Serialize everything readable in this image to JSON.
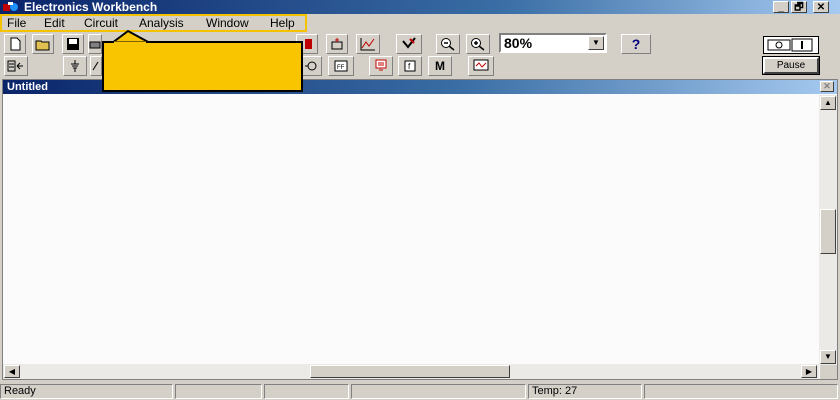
{
  "app": {
    "title": "Electronics Workbench"
  },
  "window_controls": {
    "minimize": "_",
    "restore": "🗗",
    "close": "✕"
  },
  "menu": [
    {
      "label": "File"
    },
    {
      "label": "Edit"
    },
    {
      "label": "Circuit"
    },
    {
      "label": "Analysis"
    },
    {
      "label": "Window"
    },
    {
      "label": "Help"
    }
  ],
  "toolbar": {
    "zoom_value": "80%",
    "help_label": "?",
    "pause_label": "Pause",
    "m_label": "M",
    "icons": [
      "new-icon",
      "open-icon",
      "save-icon",
      "print-icon",
      "cut-icon",
      "copy-icon",
      "paste-icon",
      "rotate-icon",
      "flip-icon",
      "subcircuit-icon",
      "graph-icon",
      "component-icon",
      "zoom-out-icon",
      "zoom-in-icon",
      "help-icon"
    ]
  },
  "parts_bin": {
    "icons": [
      "favorites-icon",
      "sources-icon",
      "basic-icon",
      "diodes-icon",
      "indicators-icon",
      "controls-icon",
      "miscellaneous-icon",
      "instruments-icon"
    ]
  },
  "document": {
    "title": "Untitled"
  },
  "status": {
    "ready": "Ready",
    "temp": "Temp:  27"
  },
  "colors": {
    "callout": "#f9c400",
    "title_bar": "#0a246a",
    "highlight": "#f5c200"
  }
}
